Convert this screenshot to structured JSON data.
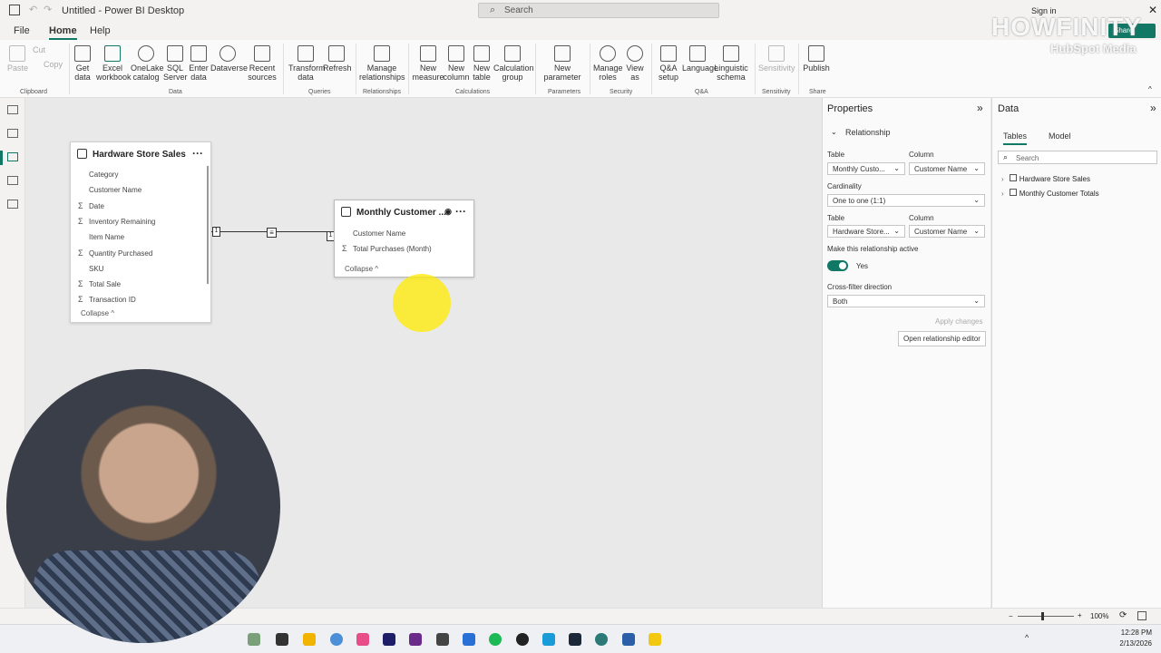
{
  "window": {
    "title": "Untitled - Power BI Desktop",
    "search_placeholder": "Search",
    "sign_in": "Sign in",
    "share": "Share"
  },
  "menu": {
    "file": "File",
    "home": "Home",
    "help": "Help"
  },
  "ribbon": {
    "clipboard": {
      "paste": "Paste",
      "cut": "Cut",
      "copy": "Copy",
      "group": "Clipboard"
    },
    "data": {
      "items": [
        "Get data",
        "Excel workbook",
        "OneLake catalog",
        "SQL Server",
        "Enter data",
        "Dataverse",
        "Recent sources"
      ],
      "group": "Data"
    },
    "queries": {
      "items": [
        "Transform data",
        "Refresh"
      ],
      "group": "Queries"
    },
    "relationships": {
      "items": [
        "Manage relationships"
      ],
      "group": "Relationships"
    },
    "calculations": {
      "items": [
        "New measure",
        "New column",
        "New table",
        "Calculation group"
      ],
      "group": "Calculations"
    },
    "parameters": {
      "items": [
        "New parameter"
      ],
      "group": "Parameters"
    },
    "security": {
      "items": [
        "Manage roles",
        "View as"
      ],
      "group": "Security"
    },
    "qa": {
      "items": [
        "Q&A setup",
        "Language",
        "Linguistic schema"
      ],
      "group": "Q&A"
    },
    "sensitivity": {
      "items": [
        "Sensitivity"
      ],
      "group": "Sensitivity"
    },
    "share": {
      "items": [
        "Publish"
      ],
      "group": "Share"
    }
  },
  "model": {
    "table1": {
      "title": "Hardware Store Sales",
      "fields": [
        {
          "name": "Category",
          "sigma": false
        },
        {
          "name": "Customer Name",
          "sigma": false
        },
        {
          "name": "Date",
          "sigma": true
        },
        {
          "name": "Inventory Remaining",
          "sigma": true
        },
        {
          "name": "Item Name",
          "sigma": false
        },
        {
          "name": "Quantity Purchased",
          "sigma": true
        },
        {
          "name": "SKU",
          "sigma": false
        },
        {
          "name": "Total Sale",
          "sigma": true
        },
        {
          "name": "Transaction ID",
          "sigma": true
        }
      ],
      "collapse": "Collapse ^"
    },
    "table2": {
      "title": "Monthly Customer ...",
      "fields": [
        {
          "name": "Customer Name",
          "sigma": false
        },
        {
          "name": "Total Purchases (Month)",
          "sigma": true
        }
      ],
      "collapse": "Collapse ^"
    },
    "rel": {
      "left": "1",
      "mid": "≡",
      "right": "1"
    }
  },
  "properties": {
    "title": "Properties",
    "section": "Relationship",
    "table_label": "Table",
    "column_label": "Column",
    "table1": "Monthly Custo...",
    "column1": "Customer Name",
    "cardinality_label": "Cardinality",
    "cardinality": "One to one (1:1)",
    "table2": "Hardware Store...",
    "column2": "Customer Name",
    "active_label": "Make this relationship active",
    "active_value": "Yes",
    "crossfilter_label": "Cross-filter direction",
    "crossfilter": "Both",
    "apply": "Apply changes",
    "open_editor": "Open relationship editor"
  },
  "data_pane": {
    "title": "Data",
    "tab_tables": "Tables",
    "tab_model": "Model",
    "search_placeholder": "Search",
    "tables": [
      "Hardware Store Sales",
      "Monthly Customer Totals"
    ]
  },
  "status": {
    "zoom": "100%"
  },
  "clock": {
    "time": "12:28 PM",
    "date": "2/13/2026"
  },
  "watermark": {
    "brand": "HOWFINITY",
    "sub": "HubSpot Media"
  }
}
